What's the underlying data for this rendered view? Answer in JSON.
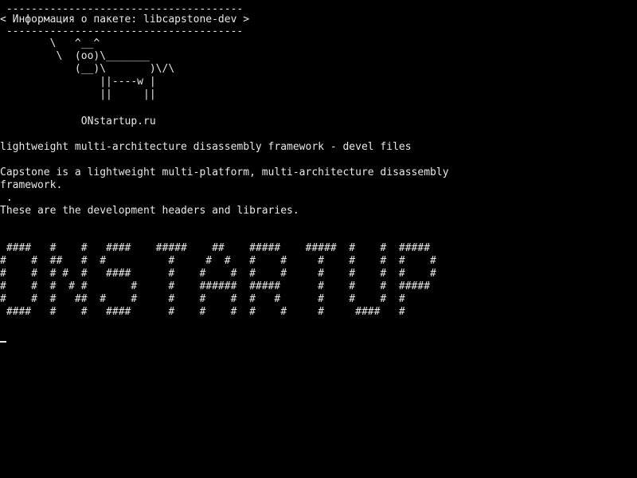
{
  "header": {
    "top_border": " --------------------------------------",
    "title": "< Информация о пакете: libcapstone-dev >",
    "bottom_border": " --------------------------------------"
  },
  "cow": [
    "        \\   ^__^",
    "         \\  (oo)\\_______",
    "            (__)\\       )\\/\\",
    "                ||----w |",
    "                ||     ||"
  ],
  "site": "             ONstartup.ru",
  "summary": "lightweight multi-architecture disassembly framework - devel files",
  "description": [
    "Capstone is a lightweight multi-platform, multi-architecture disassembly",
    "framework.",
    " .",
    "These are the development headers and libraries."
  ],
  "banner": [
    " ####   #    #   ####    #####    ##    #####    #####  #    #  #####",
    "#    #  ##   #  #          #     #  #   #    #     #    #    #  #    #",
    "#    #  # #  #   ####      #    #    #  #    #     #    #    #  #    #",
    "#    #  #  # #       #     #    ######  #####      #    #    #  #####",
    "#    #  #   ##  #    #     #    #    #  #   #      #    #    #  #",
    " ####   #    #   ####      #    #    #  #    #     #     ####   #"
  ]
}
